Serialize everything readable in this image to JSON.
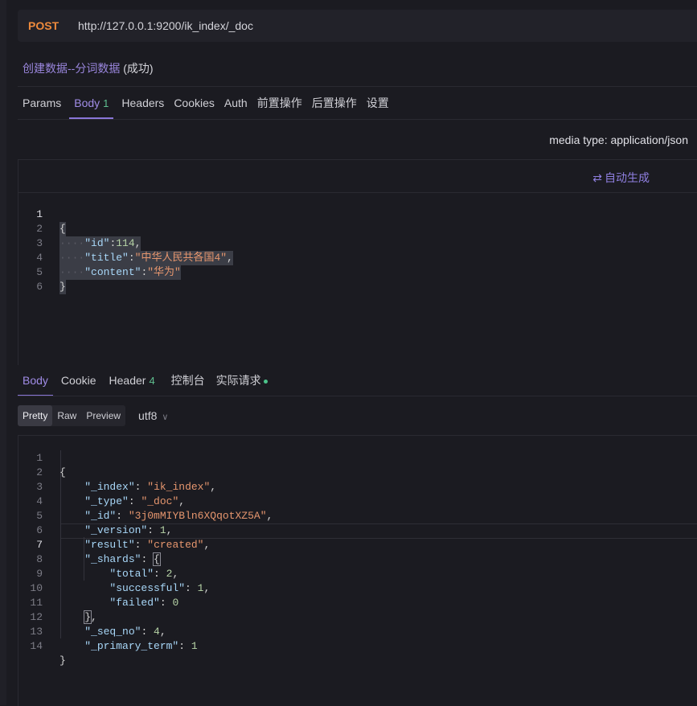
{
  "request": {
    "method": "POST",
    "url": "http://127.0.0.1:9200/ik_index/_doc",
    "name": "创建数据--分词数据",
    "status": "(成功)"
  },
  "request_tabs": [
    {
      "label": "Params"
    },
    {
      "label": "Body",
      "badge": "1"
    },
    {
      "label": "Headers"
    },
    {
      "label": "Cookies"
    },
    {
      "label": "Auth"
    },
    {
      "label": "前置操作"
    },
    {
      "label": "后置操作"
    },
    {
      "label": "设置"
    }
  ],
  "media_type": "media type: application/json",
  "auto_generate": "自动生成",
  "request_body": {
    "line_numbers": [
      "1",
      "2",
      "3",
      "4",
      "5",
      "6"
    ]
  },
  "response_tabs": [
    {
      "label": "Body"
    },
    {
      "label": "Cookie"
    },
    {
      "label": "Header",
      "badge": "4"
    },
    {
      "label": "控制台"
    },
    {
      "label": "实际请求"
    }
  ],
  "response_formats": [
    "Pretty",
    "Raw",
    "Preview"
  ],
  "charset": "utf8",
  "response_body": {
    "line_numbers": [
      "1",
      "2",
      "3",
      "4",
      "5",
      "6",
      "7",
      "8",
      "9",
      "10",
      "11",
      "12",
      "13",
      "14"
    ],
    "index": "ik_index",
    "type": "_doc",
    "id": "3j0mMIYBln6XQqotXZ5A",
    "version": "1",
    "result": "created",
    "total": "2",
    "successful": "1",
    "failed": "0",
    "seq_no": "4",
    "primary_term": "1"
  },
  "colors": {
    "accent": "#8a76d8",
    "method_post": "#ee8a3c",
    "json_key": "#a8d7f8",
    "json_string": "#e6966e",
    "json_number": "#b6d3a6",
    "background": "#1b1b21"
  }
}
